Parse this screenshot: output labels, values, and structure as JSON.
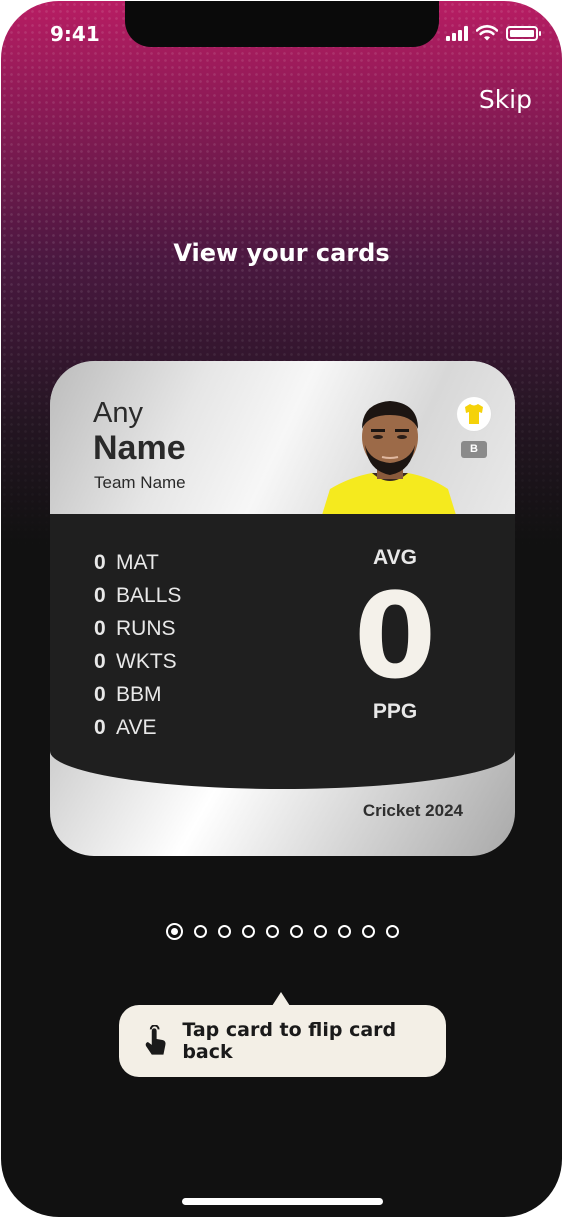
{
  "status_bar": {
    "time": "9:41"
  },
  "header": {
    "skip_label": "Skip",
    "title": "View your cards"
  },
  "card": {
    "first_name": "Any",
    "last_name": "Name",
    "team_name": "Team Name",
    "grade": "B",
    "stats": [
      {
        "value": "0",
        "label": "MAT"
      },
      {
        "value": "0",
        "label": "BALLS"
      },
      {
        "value": "0",
        "label": "RUNS"
      },
      {
        "value": "0",
        "label": "WKTS"
      },
      {
        "value": "0",
        "label": "BBM"
      },
      {
        "value": "0",
        "label": "AVE"
      }
    ],
    "avg_label": "AVG",
    "avg_value": "0",
    "ppg_label": "PPG",
    "footer": "Cricket 2024",
    "jersey_color": "#f5d20a"
  },
  "pager": {
    "total": 10,
    "active_index": 0
  },
  "tooltip": {
    "text": "Tap card to flip card back",
    "icon": "tap-hand-icon"
  },
  "colors": {
    "brand": "#b81d63",
    "background": "#111111",
    "tooltip_bg": "#f3efe6"
  }
}
